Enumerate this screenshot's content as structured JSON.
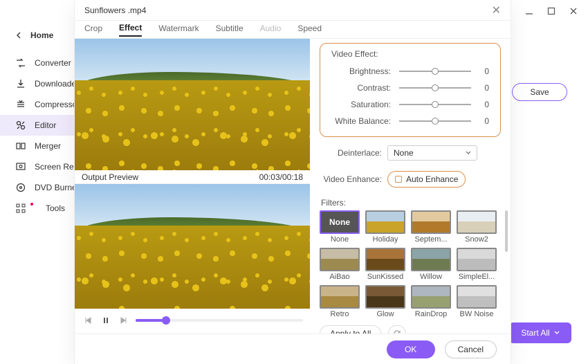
{
  "mainWindow": {
    "home": "Home",
    "nav": [
      {
        "label": "Converter"
      },
      {
        "label": "Downloader"
      },
      {
        "label": "Compressor"
      },
      {
        "label": "Editor",
        "active": true
      },
      {
        "label": "Merger"
      },
      {
        "label": "Screen Record"
      },
      {
        "label": "DVD Burner"
      },
      {
        "label": "Tools",
        "badge": true
      }
    ],
    "save": "Save",
    "startAll": "Start All"
  },
  "dialog": {
    "title": "Sunflowers .mp4",
    "tabs": [
      {
        "label": "Crop"
      },
      {
        "label": "Effect",
        "active": true
      },
      {
        "label": "Watermark"
      },
      {
        "label": "Subtitle"
      },
      {
        "label": "Audio",
        "disabled": true
      },
      {
        "label": "Speed"
      }
    ],
    "outputPreview": "Output Preview",
    "time": "00:03/00:18",
    "effectPanel": {
      "title": "Video Effect:",
      "sliders": [
        {
          "label": "Brightness:",
          "value": "0"
        },
        {
          "label": "Contrast:",
          "value": "0"
        },
        {
          "label": "Saturation:",
          "value": "0"
        },
        {
          "label": "White Balance:",
          "value": "0"
        }
      ]
    },
    "deinterlaceLabel": "Deinterlace:",
    "deinterlaceValue": "None",
    "videoEnhanceLabel": "Video Enhance:",
    "autoEnhance": "Auto Enhance",
    "filtersLabel": "Filters:",
    "filters": [
      {
        "name": "None",
        "none": true,
        "selected": true,
        "sky": "#555",
        "ground": "#555"
      },
      {
        "name": "Holiday",
        "sky": "#b8cfe2",
        "ground": "#caa428"
      },
      {
        "name": "Septem...",
        "sky": "#e2c9a0",
        "ground": "#b07a2a"
      },
      {
        "name": "Snow2",
        "sky": "#e9eef3",
        "ground": "#d8d0b8"
      },
      {
        "name": "AiBao",
        "sky": "#c7bca5",
        "ground": "#9c8a50"
      },
      {
        "name": "SunKissed",
        "sky": "#a8743a",
        "ground": "#6a4a1a"
      },
      {
        "name": "Willow",
        "sky": "#8aa4a7",
        "ground": "#6e7a52"
      },
      {
        "name": "SimpleEl...",
        "sky": "#d9d9d9",
        "ground": "#bcbcbc"
      },
      {
        "name": "Retro",
        "sky": "#c9b48a",
        "ground": "#a88a42"
      },
      {
        "name": "Glow",
        "sky": "#7a5a36",
        "ground": "#4a3618"
      },
      {
        "name": "RainDrop",
        "sky": "#aeb7bf",
        "ground": "#97a070"
      },
      {
        "name": "BW Noise",
        "sky": "#e0e0e0",
        "ground": "#bfbfbf"
      }
    ],
    "applyToAll": "Apply to All",
    "ok": "OK",
    "cancel": "Cancel"
  }
}
